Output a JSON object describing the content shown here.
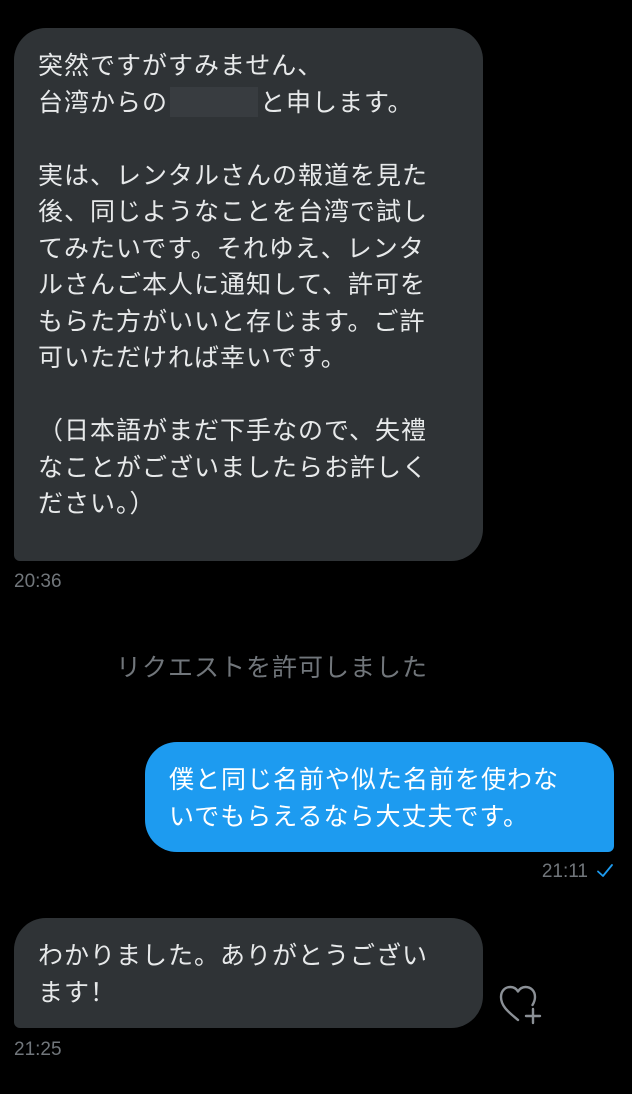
{
  "conversation": {
    "messages": [
      {
        "direction": "incoming",
        "text_before_redaction": "突然ですがすみません、\n台湾からの",
        "text_after_redaction": "と申します。\n\n実は、レンタルさんの報道を見た\n後、同じようなことを台湾で試し\nてみたいです。それゆえ、レンタ\nルさんご本人に通知して、許可を\nもらた方がいいと存じます。ご許\n可いただければ幸いです。\n\n（日本語がまだ下手なので、失禮\nなことがございましたらお許しく\nださい。）",
        "timestamp": "20:36"
      },
      {
        "direction": "system",
        "text": "リクエストを許可しました"
      },
      {
        "direction": "outgoing",
        "text": "僕と同じ名前や似た名前を使わな\nいでもらえるなら大丈夫です。",
        "timestamp": "21:11",
        "read_icon": "check-icon"
      },
      {
        "direction": "incoming",
        "text": "わかりました。ありがとうござい\nます！",
        "timestamp": "21:25",
        "reaction_icon": "heart-plus-icon"
      }
    ]
  },
  "colors": {
    "background": "#000000",
    "incoming_bubble": "#2f3336",
    "outgoing_bubble": "#1d9bf0",
    "muted_text": "#71767b",
    "redaction": "#383c40"
  }
}
